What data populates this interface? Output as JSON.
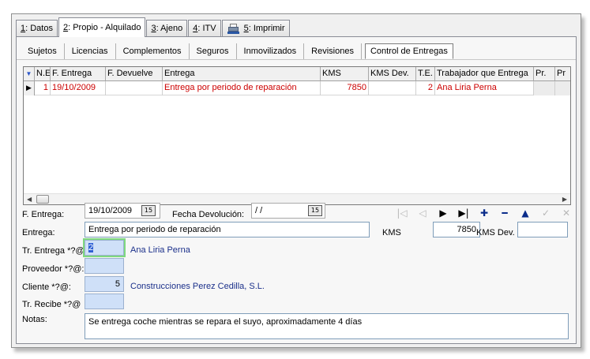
{
  "tabs": [
    {
      "num": "1",
      "label": ": Datos"
    },
    {
      "num": "2",
      "label": ": Propio - Alquilado"
    },
    {
      "num": "3",
      "label": ": Ajeno"
    },
    {
      "num": "4",
      "label": ": ITV"
    },
    {
      "num": "5",
      "label": ": Imprimir"
    }
  ],
  "subtabs": [
    "Sujetos",
    "Licencias",
    "Complementos",
    "Seguros",
    "Inmovilizados",
    "Revisiones",
    "Control de Entregas"
  ],
  "grid": {
    "headers": [
      "N.E",
      "F. Entrega",
      "F. Devuelve",
      "Entrega",
      "KMS",
      "KMS Dev.",
      "T.E.",
      "Trabajador que Entrega",
      "Pr.",
      "Pr"
    ],
    "rows": [
      {
        "indicator": "▶",
        "cells": [
          "1",
          "19/10/2009",
          "",
          "Entrega por periodo de reparación",
          "7850",
          "",
          "2",
          "Ana Liria Perna",
          "",
          ""
        ]
      }
    ]
  },
  "form": {
    "f_entrega_label": "F. Entrega:",
    "f_entrega_value": "19/10/2009",
    "cal_glyph": "15",
    "fecha_devolucion_label": "Fecha Devolución:",
    "fecha_devolucion_value": "/ /",
    "entrega_label": "Entrega:",
    "entrega_value": "Entrega por periodo de reparación",
    "kms_label": "KMS",
    "kms_value": "7850",
    "kms_dev_label": "KMS Dev.",
    "kms_dev_value": "",
    "tr_entrega_label": "Tr. Entrega *?@",
    "tr_entrega_value": "2",
    "tr_entrega_name": "Ana Liria Perna",
    "proveedor_label": "Proveedor *?@:",
    "proveedor_value": "",
    "cliente_label": "Cliente *?@:",
    "cliente_value": "5",
    "cliente_name": "Construcciones Perez Cedilla, S.L.",
    "tr_recibe_label": "Tr. Recibe *?@",
    "tr_recibe_value": "",
    "notas_label": "Notas:",
    "notas_value": "Se entrega coche mientras se repara el suyo, aproximadamente 4 días"
  },
  "navigator": [
    {
      "glyph": "|◁",
      "icon": "first-record-icon",
      "enabled": false
    },
    {
      "glyph": "◁",
      "icon": "prior-record-icon",
      "enabled": false
    },
    {
      "glyph": "▶",
      "icon": "next-record-icon",
      "enabled": true
    },
    {
      "glyph": "▶|",
      "icon": "last-record-icon",
      "enabled": true
    },
    {
      "glyph": "✚",
      "icon": "insert-record-icon",
      "enabled": true
    },
    {
      "glyph": "━",
      "icon": "delete-record-icon",
      "enabled": true
    },
    {
      "glyph": "▲",
      "icon": "edit-record-icon",
      "enabled": true
    },
    {
      "glyph": "✓",
      "icon": "post-record-icon",
      "enabled": false
    },
    {
      "glyph": "✕",
      "icon": "cancel-record-icon",
      "enabled": false
    }
  ],
  "colors": {
    "accent_red": "#cc0000",
    "lookup_blue": "#1a2f8a",
    "lookup_field_bg": "#cfe0f8",
    "focus_green": "#7fd97f"
  }
}
